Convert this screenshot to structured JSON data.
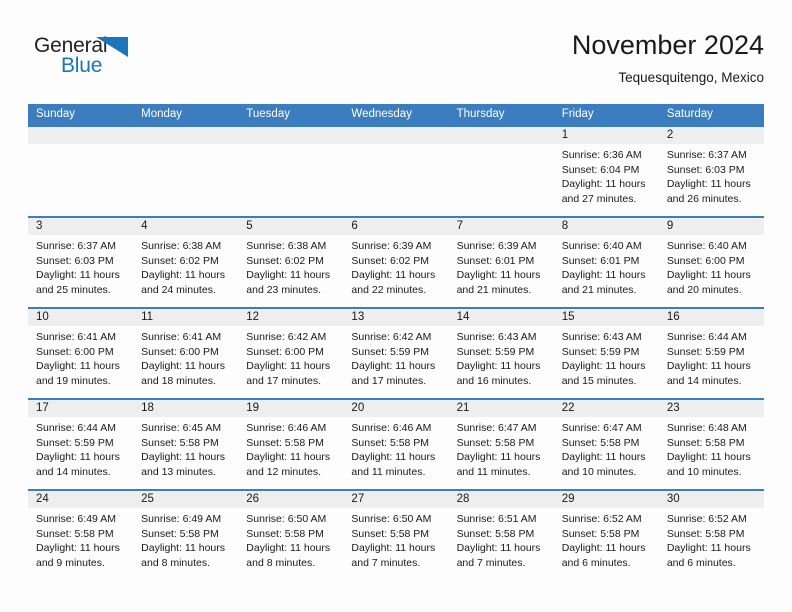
{
  "brand": {
    "name_part1": "General",
    "name_part2": "Blue",
    "triangle_icon": "triangle-icon",
    "colors": {
      "blue": "#1b75bb",
      "dark": "#231f20"
    }
  },
  "header": {
    "month_title": "November 2024",
    "location": "Tequesquitengo, Mexico"
  },
  "theme": {
    "header_blue": "#3b7dbf",
    "number_band_gray": "#eeeeee",
    "cell_white": "#fdfdfd",
    "text": "#1a1a1a"
  },
  "weekdays": [
    "Sunday",
    "Monday",
    "Tuesday",
    "Wednesday",
    "Thursday",
    "Friday",
    "Saturday"
  ],
  "weeks": [
    {
      "days": [
        {
          "num": "",
          "empty": true
        },
        {
          "num": "",
          "empty": true
        },
        {
          "num": "",
          "empty": true
        },
        {
          "num": "",
          "empty": true
        },
        {
          "num": "",
          "empty": true
        },
        {
          "num": "1",
          "sunrise": "Sunrise: 6:36 AM",
          "sunset": "Sunset: 6:04 PM",
          "daylight_l1": "Daylight: 11 hours",
          "daylight_l2": "and 27 minutes."
        },
        {
          "num": "2",
          "sunrise": "Sunrise: 6:37 AM",
          "sunset": "Sunset: 6:03 PM",
          "daylight_l1": "Daylight: 11 hours",
          "daylight_l2": "and 26 minutes."
        }
      ]
    },
    {
      "days": [
        {
          "num": "3",
          "sunrise": "Sunrise: 6:37 AM",
          "sunset": "Sunset: 6:03 PM",
          "daylight_l1": "Daylight: 11 hours",
          "daylight_l2": "and 25 minutes."
        },
        {
          "num": "4",
          "sunrise": "Sunrise: 6:38 AM",
          "sunset": "Sunset: 6:02 PM",
          "daylight_l1": "Daylight: 11 hours",
          "daylight_l2": "and 24 minutes."
        },
        {
          "num": "5",
          "sunrise": "Sunrise: 6:38 AM",
          "sunset": "Sunset: 6:02 PM",
          "daylight_l1": "Daylight: 11 hours",
          "daylight_l2": "and 23 minutes."
        },
        {
          "num": "6",
          "sunrise": "Sunrise: 6:39 AM",
          "sunset": "Sunset: 6:02 PM",
          "daylight_l1": "Daylight: 11 hours",
          "daylight_l2": "and 22 minutes."
        },
        {
          "num": "7",
          "sunrise": "Sunrise: 6:39 AM",
          "sunset": "Sunset: 6:01 PM",
          "daylight_l1": "Daylight: 11 hours",
          "daylight_l2": "and 21 minutes."
        },
        {
          "num": "8",
          "sunrise": "Sunrise: 6:40 AM",
          "sunset": "Sunset: 6:01 PM",
          "daylight_l1": "Daylight: 11 hours",
          "daylight_l2": "and 21 minutes."
        },
        {
          "num": "9",
          "sunrise": "Sunrise: 6:40 AM",
          "sunset": "Sunset: 6:00 PM",
          "daylight_l1": "Daylight: 11 hours",
          "daylight_l2": "and 20 minutes."
        }
      ]
    },
    {
      "days": [
        {
          "num": "10",
          "sunrise": "Sunrise: 6:41 AM",
          "sunset": "Sunset: 6:00 PM",
          "daylight_l1": "Daylight: 11 hours",
          "daylight_l2": "and 19 minutes."
        },
        {
          "num": "11",
          "sunrise": "Sunrise: 6:41 AM",
          "sunset": "Sunset: 6:00 PM",
          "daylight_l1": "Daylight: 11 hours",
          "daylight_l2": "and 18 minutes."
        },
        {
          "num": "12",
          "sunrise": "Sunrise: 6:42 AM",
          "sunset": "Sunset: 6:00 PM",
          "daylight_l1": "Daylight: 11 hours",
          "daylight_l2": "and 17 minutes."
        },
        {
          "num": "13",
          "sunrise": "Sunrise: 6:42 AM",
          "sunset": "Sunset: 5:59 PM",
          "daylight_l1": "Daylight: 11 hours",
          "daylight_l2": "and 17 minutes."
        },
        {
          "num": "14",
          "sunrise": "Sunrise: 6:43 AM",
          "sunset": "Sunset: 5:59 PM",
          "daylight_l1": "Daylight: 11 hours",
          "daylight_l2": "and 16 minutes."
        },
        {
          "num": "15",
          "sunrise": "Sunrise: 6:43 AM",
          "sunset": "Sunset: 5:59 PM",
          "daylight_l1": "Daylight: 11 hours",
          "daylight_l2": "and 15 minutes."
        },
        {
          "num": "16",
          "sunrise": "Sunrise: 6:44 AM",
          "sunset": "Sunset: 5:59 PM",
          "daylight_l1": "Daylight: 11 hours",
          "daylight_l2": "and 14 minutes."
        }
      ]
    },
    {
      "days": [
        {
          "num": "17",
          "sunrise": "Sunrise: 6:44 AM",
          "sunset": "Sunset: 5:59 PM",
          "daylight_l1": "Daylight: 11 hours",
          "daylight_l2": "and 14 minutes."
        },
        {
          "num": "18",
          "sunrise": "Sunrise: 6:45 AM",
          "sunset": "Sunset: 5:58 PM",
          "daylight_l1": "Daylight: 11 hours",
          "daylight_l2": "and 13 minutes."
        },
        {
          "num": "19",
          "sunrise": "Sunrise: 6:46 AM",
          "sunset": "Sunset: 5:58 PM",
          "daylight_l1": "Daylight: 11 hours",
          "daylight_l2": "and 12 minutes."
        },
        {
          "num": "20",
          "sunrise": "Sunrise: 6:46 AM",
          "sunset": "Sunset: 5:58 PM",
          "daylight_l1": "Daylight: 11 hours",
          "daylight_l2": "and 11 minutes."
        },
        {
          "num": "21",
          "sunrise": "Sunrise: 6:47 AM",
          "sunset": "Sunset: 5:58 PM",
          "daylight_l1": "Daylight: 11 hours",
          "daylight_l2": "and 11 minutes."
        },
        {
          "num": "22",
          "sunrise": "Sunrise: 6:47 AM",
          "sunset": "Sunset: 5:58 PM",
          "daylight_l1": "Daylight: 11 hours",
          "daylight_l2": "and 10 minutes."
        },
        {
          "num": "23",
          "sunrise": "Sunrise: 6:48 AM",
          "sunset": "Sunset: 5:58 PM",
          "daylight_l1": "Daylight: 11 hours",
          "daylight_l2": "and 10 minutes."
        }
      ]
    },
    {
      "days": [
        {
          "num": "24",
          "sunrise": "Sunrise: 6:49 AM",
          "sunset": "Sunset: 5:58 PM",
          "daylight_l1": "Daylight: 11 hours",
          "daylight_l2": "and 9 minutes."
        },
        {
          "num": "25",
          "sunrise": "Sunrise: 6:49 AM",
          "sunset": "Sunset: 5:58 PM",
          "daylight_l1": "Daylight: 11 hours",
          "daylight_l2": "and 8 minutes."
        },
        {
          "num": "26",
          "sunrise": "Sunrise: 6:50 AM",
          "sunset": "Sunset: 5:58 PM",
          "daylight_l1": "Daylight: 11 hours",
          "daylight_l2": "and 8 minutes."
        },
        {
          "num": "27",
          "sunrise": "Sunrise: 6:50 AM",
          "sunset": "Sunset: 5:58 PM",
          "daylight_l1": "Daylight: 11 hours",
          "daylight_l2": "and 7 minutes."
        },
        {
          "num": "28",
          "sunrise": "Sunrise: 6:51 AM",
          "sunset": "Sunset: 5:58 PM",
          "daylight_l1": "Daylight: 11 hours",
          "daylight_l2": "and 7 minutes."
        },
        {
          "num": "29",
          "sunrise": "Sunrise: 6:52 AM",
          "sunset": "Sunset: 5:58 PM",
          "daylight_l1": "Daylight: 11 hours",
          "daylight_l2": "and 6 minutes."
        },
        {
          "num": "30",
          "sunrise": "Sunrise: 6:52 AM",
          "sunset": "Sunset: 5:58 PM",
          "daylight_l1": "Daylight: 11 hours",
          "daylight_l2": "and 6 minutes."
        }
      ]
    }
  ]
}
